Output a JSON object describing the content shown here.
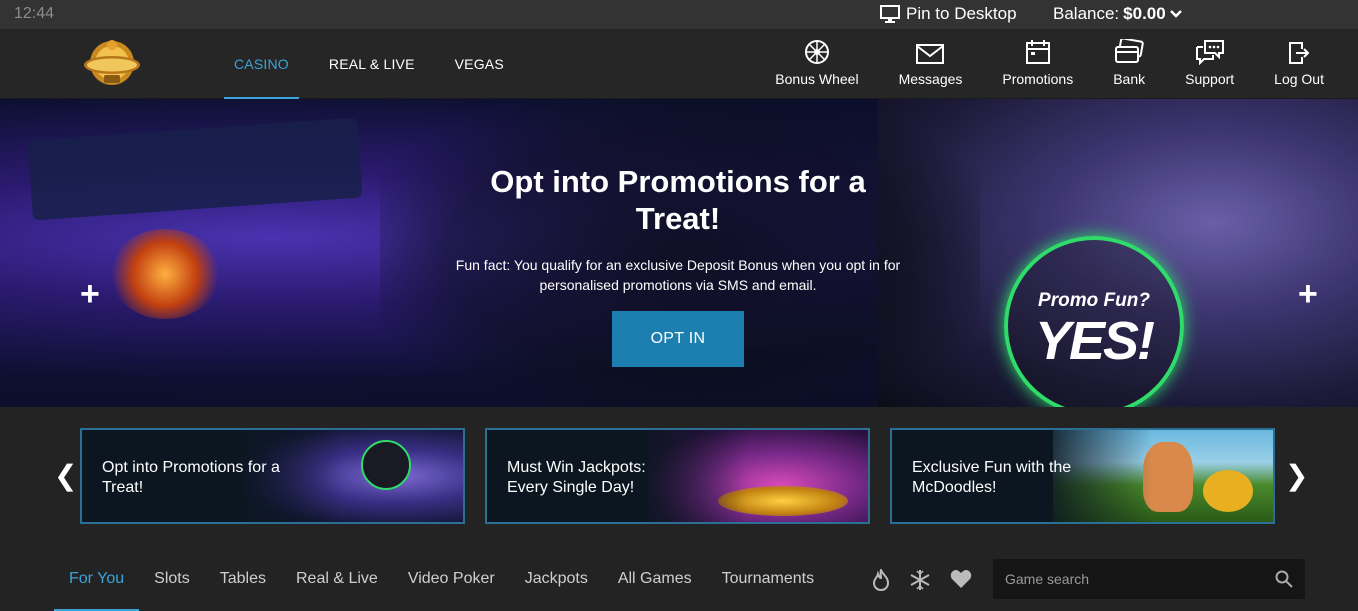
{
  "statusbar": {
    "time": "12:44",
    "pin_label": "Pin to Desktop",
    "balance_label": "Balance:",
    "balance_value": "$0.00"
  },
  "header": {
    "logo_icon": "casino-logo-icon",
    "nav": [
      {
        "label": "CASINO",
        "active": true
      },
      {
        "label": "REAL & LIVE",
        "active": false
      },
      {
        "label": "VEGAS",
        "active": false
      }
    ],
    "tools": [
      {
        "label": "Bonus Wheel",
        "icon": "wheel-icon"
      },
      {
        "label": "Messages",
        "icon": "envelope-icon"
      },
      {
        "label": "Promotions",
        "icon": "calendar-icon"
      },
      {
        "label": "Bank",
        "icon": "cards-icon"
      },
      {
        "label": "Support",
        "icon": "chat-icon"
      },
      {
        "label": "Log Out",
        "icon": "logout-icon"
      }
    ]
  },
  "hero": {
    "title": "Opt into Promotions for a Treat!",
    "description": "Fun fact: You qualify for an exclusive Deposit Bonus when you opt in for personalised promotions via SMS and email.",
    "button_label": "OPT IN",
    "badge_small": "Promo Fun?",
    "badge_big": "YES!"
  },
  "cards": [
    {
      "label": "Opt into Promotions for a Treat!"
    },
    {
      "label": "Must Win Jackpots: Every Single Day!"
    },
    {
      "label": "Exclusive Fun with the McDoodles!"
    }
  ],
  "tabs": [
    {
      "label": "For You",
      "active": true
    },
    {
      "label": "Slots",
      "active": false
    },
    {
      "label": "Tables",
      "active": false
    },
    {
      "label": "Real & Live",
      "active": false
    },
    {
      "label": "Video Poker",
      "active": false
    },
    {
      "label": "Jackpots",
      "active": false
    },
    {
      "label": "All Games",
      "active": false
    },
    {
      "label": "Tournaments",
      "active": false
    }
  ],
  "search": {
    "placeholder": "Game search"
  },
  "colors": {
    "accent": "#3aa4d8",
    "button": "#1d7fb0",
    "badge_ring": "#2fdc6a",
    "card_border": "#2b6f94"
  }
}
